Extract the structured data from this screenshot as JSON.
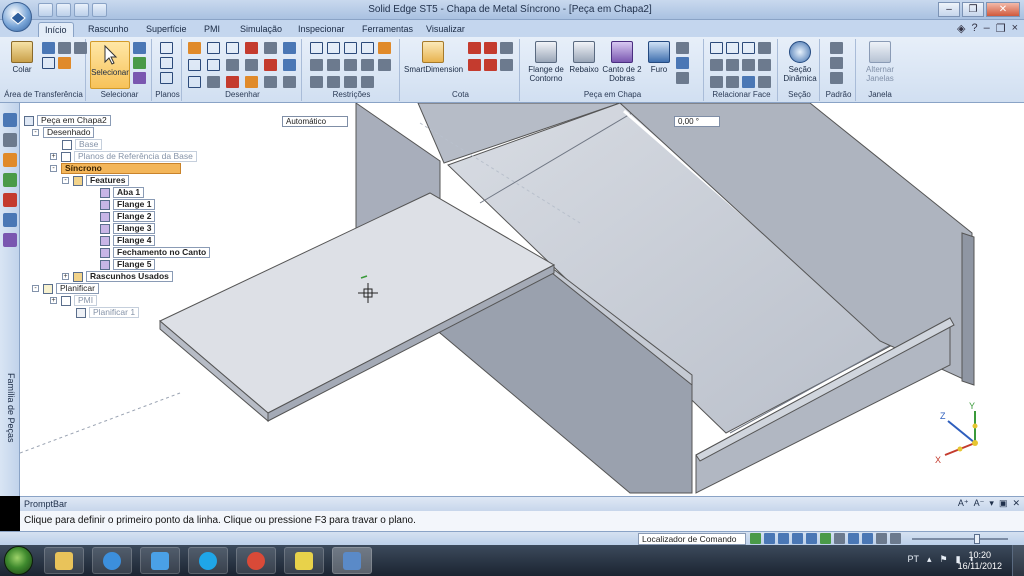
{
  "window": {
    "title": "Solid Edge ST5 - Chapa de Metal Síncrono - [Peça em Chapa2]",
    "buttons": [
      "–",
      "❐",
      "✕"
    ]
  },
  "ribbon_tabs": [
    "Início",
    "Rascunho",
    "Superfície",
    "PMI",
    "Simulação",
    "Inspecionar",
    "Ferramentas",
    "Visualizar"
  ],
  "ribbon": {
    "clipboard": {
      "paste_label": "Colar",
      "group_label": "Área de Transferência"
    },
    "select": {
      "select_label": "Selecionar",
      "group_label": "Selecionar"
    },
    "planes": {
      "group_label": "Planos"
    },
    "draw": {
      "group_label": "Desenhar"
    },
    "relations": {
      "group_label": "Restrições"
    },
    "dimension": {
      "smartdim_label": "SmartDimension",
      "group_label": "Cota"
    },
    "sheet_metal": {
      "group_label": "Peça em Chapa",
      "buttons": [
        {
          "label": "Flange de Contorno"
        },
        {
          "label": "Rebaixo"
        },
        {
          "label": "Canto de 2 Dobras"
        },
        {
          "label": "Furo"
        }
      ]
    },
    "relate_face": {
      "group_label": "Relacionar Face"
    },
    "section": {
      "label": "Seção Dinâmica",
      "group_label": "Seção"
    },
    "standard": {
      "group_label": "Padrão"
    },
    "window": {
      "label": "Alternar Janelas",
      "group_label": "Janela"
    }
  },
  "side_toolbar": {
    "label": "Família de Peças"
  },
  "tree": {
    "root": "Peça em Chapa2",
    "designed": "Desenhado",
    "base": "Base",
    "ref_planes": "Planos de Referência da Base",
    "synchronous": "Síncrono",
    "features": "Features",
    "items": [
      "Aba 1",
      "Flange 1",
      "Flange 2",
      "Flange 3",
      "Flange 4",
      "Fechamento no Canto",
      "Flange 5"
    ],
    "used_sketches": "Rascunhos Usados",
    "flatten": "Planificar",
    "pmi": "PMI",
    "flatten_item": "Planificar 1"
  },
  "viewport": {
    "mode_field": "Automático",
    "angle_field": "0,00 °",
    "axes": {
      "x": "X",
      "y": "Y",
      "z": "Z"
    }
  },
  "promptbar": {
    "title": "PromptBar",
    "text": "Clique para definir o primeiro ponto da linha.  Clique ou pressione F3 para travar o plano."
  },
  "statusbar": {
    "command_finder": "Localizador de Comando"
  },
  "taskbar": {
    "lang": "PT",
    "time": "10:20",
    "date": "16/11/2012"
  }
}
